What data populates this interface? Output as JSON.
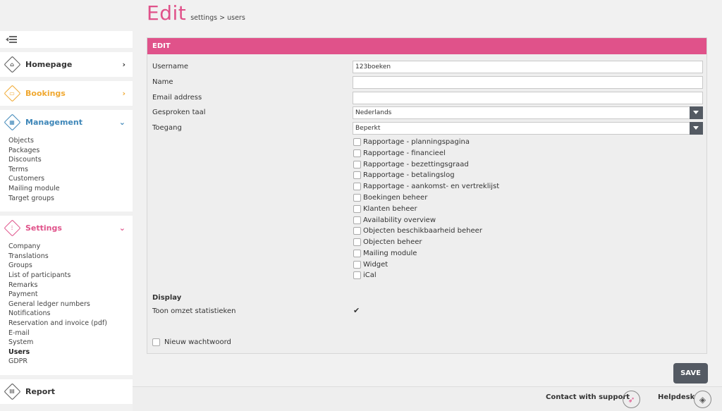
{
  "header": {
    "title": "Edit",
    "breadcrumb": "settings > users"
  },
  "sidebar": {
    "homepage": {
      "label": "Homepage",
      "icon": "home-icon",
      "color": "#555555"
    },
    "bookings": {
      "label": "Bookings",
      "icon": "calendar-icon",
      "color": "#f0a830"
    },
    "management": {
      "label": "Management",
      "icon": "grid-icon",
      "color": "#3d86b8",
      "items": [
        "Objects",
        "Packages",
        "Discounts",
        "Terms",
        "Customers",
        "Mailing module",
        "Target groups"
      ]
    },
    "settings": {
      "label": "Settings",
      "icon": "sliders-icon",
      "color": "#e0528a",
      "items": [
        "Company",
        "Translations",
        "Groups",
        "List of participants",
        "Remarks",
        "Payment",
        "General ledger numbers",
        "Notifications",
        "Reservation and invoice (pdf)",
        "E-mail",
        "System",
        "Users",
        "GDPR"
      ],
      "active": "Users"
    },
    "report": {
      "label": "Report"
    }
  },
  "panel": {
    "heading": "EDIT",
    "fields": {
      "username": {
        "label": "Username",
        "value": "123boeken"
      },
      "name": {
        "label": "Name",
        "value": ""
      },
      "email": {
        "label": "Email address",
        "value": ""
      },
      "language": {
        "label": "Gesproken taal",
        "value": "Nederlands"
      },
      "access": {
        "label": "Toegang",
        "value": "Beperkt"
      }
    },
    "permissions": [
      "Rapportage - planningspagina",
      "Rapportage - financieel",
      "Rapportage - bezettingsgraad",
      "Rapportage - betalingslog",
      "Rapportage - aankomst- en vertreklijst",
      "Boekingen beheer",
      "Klanten beheer",
      "Availability overview",
      "Objecten beschikbaarheid beheer",
      "Objecten beheer",
      "Mailing module",
      "Widget",
      "iCal"
    ],
    "display": {
      "heading": "Display",
      "stats_label": "Toon omzet statistieken",
      "stats_checked": true,
      "stats_mark": "✔"
    },
    "new_password_label": "Nieuw wachtwoord"
  },
  "save_label": "SAVE",
  "footer": {
    "support_label": "Contact with support",
    "helpdesk_label": "Helpdesk"
  },
  "colors": {
    "accent": "#e0528a",
    "button": "#545a63"
  }
}
